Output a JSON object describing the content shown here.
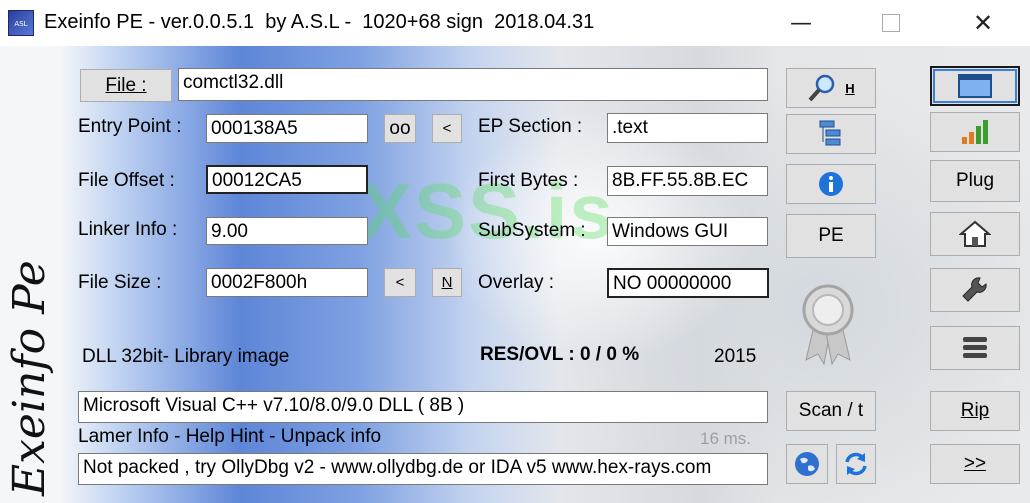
{
  "window": {
    "title": "Exeinfo PE - ver.0.0.5.1  by A.S.L -  1020+68 sign  2018.04.31",
    "icon_text": "ASL",
    "minimize_glyph": "—",
    "close_glyph": "✕"
  },
  "watermark": "XSS.is",
  "file": {
    "button_label": "File :",
    "value": "comctl32.dll"
  },
  "fields": {
    "entry_point_label": "Entry Point :",
    "entry_point_value": "000138A5",
    "oo_button": "oo",
    "lt_button": "<",
    "ep_section_label": "EP Section :",
    "ep_section_value": ".text",
    "file_offset_label": "File Offset :",
    "file_offset_value": "00012CA5",
    "first_bytes_label": "First Bytes :",
    "first_bytes_value": "8B.FF.55.8B.EC",
    "linker_label": "Linker Info :",
    "linker_value": "9.00",
    "subsystem_label": "SubSystem :",
    "subsystem_value": "Windows GUI",
    "file_size_label": "File Size :",
    "file_size_value": "0002F800h",
    "size_lt_button": "<",
    "size_n_button": "N",
    "overlay_label": "Overlay :",
    "overlay_value": "NO   00000000"
  },
  "info": {
    "image_type": "DLL 32bit- Library image",
    "res_ovl": "RES/OVL : 0 / 0 %",
    "year": "2015",
    "detection": "Microsoft Visual C++ v7.10/8.0/9.0 DLL ( 8B )",
    "lamer_info": "Lamer Info - Help Hint - Unpack info",
    "timing": "16 ms.",
    "hint": "Not packed , try OllyDbg v2 - www.ollydbg.de or IDA v5 www.hex-rays.com"
  },
  "middle_buttons": {
    "search_h": "H",
    "pe": "PE",
    "scan": "Scan / t"
  },
  "right_buttons": {
    "plug": "Plug",
    "rip": "Rip",
    "more": ">>"
  },
  "side_logo_text": "Exeinfo Pe",
  "colors": {
    "accent_blue": "#5e86d8",
    "info_blue": "#1e73d8",
    "bar_green": "#3a9c2f",
    "bar_orange": "#e07b1f"
  }
}
